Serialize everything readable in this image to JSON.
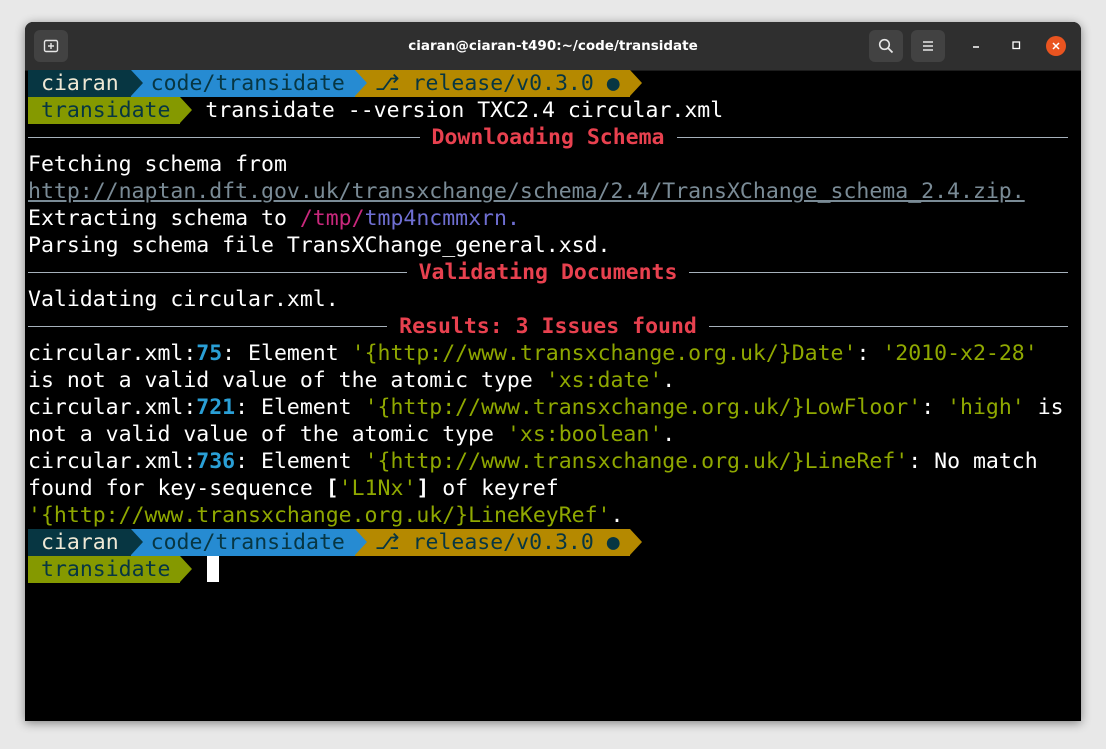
{
  "window": {
    "title": "ciaran@ciaran-t490:~/code/transidate",
    "new_tab_icon": "new-tab-icon",
    "search_icon": "search-icon",
    "menu_icon": "hamburger-menu-icon",
    "minimize_icon": "minimize-icon",
    "maximize_icon": "maximize-icon",
    "close_icon": "close-icon",
    "close_color": "#e95420"
  },
  "prompt": {
    "user": "ciaran",
    "path": "code/transidate",
    "branch_glyph": "⎇",
    "branch": "release/v0.3.0",
    "dirty_marker": "●",
    "venv": "transidate"
  },
  "command": "transidate --version TXC2.4 circular.xml",
  "sections": {
    "downloading": "Downloading Schema",
    "validating": "Validating Documents",
    "results": "Results: 3 Issues found"
  },
  "download": {
    "fetching": "Fetching schema from",
    "url": "http://naptan.dft.gov.uk/transxchange/schema/2.4/TransXChange_schema_2.4.zip.",
    "extracting": "Extracting schema to ",
    "tmp_dir": "/tmp/",
    "tmp_name": "tmp4ncmmxrn.",
    "parsing": "Parsing schema file TransXChange_general.xsd."
  },
  "validating": {
    "line": "Validating circular.xml."
  },
  "issues": [
    {
      "file": "circular.xml:",
      "line_no": "75",
      "p1": ": Element ",
      "element": "'{http://www.transxchange.org.uk/}Date'",
      "p2": ": ",
      "value": "'2010-x2-28'",
      "p3": "is not a valid value of the atomic type ",
      "type": "'xs:date'",
      "end": "."
    },
    {
      "file": "circular.xml:",
      "line_no": "721",
      "p1": ": Element ",
      "element": "'{http://www.transxchange.org.uk/}LowFloor'",
      "p2": ": ",
      "value": "'high'",
      "p2b": " is",
      "p3": "not a valid value of the atomic type ",
      "type": "'xs:boolean'",
      "end": "."
    },
    {
      "file": "circular.xml:",
      "line_no": "736",
      "p1": ": Element ",
      "element": "'{http://www.transxchange.org.uk/}LineRef'",
      "p2": ": No match",
      "p3": "found for key-sequence ",
      "bracket_open": "[",
      "key": "'L1Nx'",
      "bracket_close": "]",
      "p4": " of keyref",
      "keyref": "'{http://www.transxchange.org.uk/}LineKeyRef'",
      "end": "."
    }
  ],
  "colors": {
    "terminal_bg": "#000000",
    "section_title": "#e8414f",
    "string": "#8fa800",
    "line_number": "#2a9fd6",
    "url": "#7a8b96",
    "seg_user": "#073642",
    "seg_path": "#268bd2",
    "seg_git": "#b58900",
    "seg_venv": "#859900"
  }
}
